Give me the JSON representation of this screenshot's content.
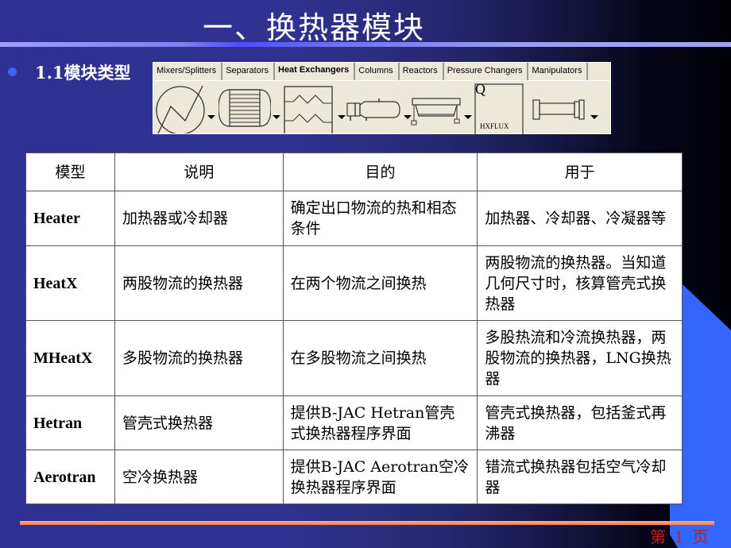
{
  "slide": {
    "title": "一、换热器模块",
    "subtitle": "1.1模块类型",
    "page_label": "第 1 页"
  },
  "palette": {
    "tabs": [
      {
        "label": "Mixers/Splitters",
        "active": false
      },
      {
        "label": "Separators",
        "active": false
      },
      {
        "label": "Heat Exchangers",
        "active": true
      },
      {
        "label": "Columns",
        "active": false
      },
      {
        "label": "Reactors",
        "active": false
      },
      {
        "label": "Pressure Changers",
        "active": false
      },
      {
        "label": "Manipulators",
        "active": false
      }
    ],
    "icons": [
      {
        "name": "heater-icon"
      },
      {
        "name": "heatx-icon"
      },
      {
        "name": "mheatx-icon"
      },
      {
        "name": "hetran-icon"
      },
      {
        "name": "aerotran-icon"
      },
      {
        "name": "hxflux-icon",
        "label": "HXFLUX",
        "glyph": "Q"
      },
      {
        "name": "hetran-manipulator-icon"
      }
    ]
  },
  "table": {
    "headers": [
      "模型",
      "说明",
      "目的",
      "用于"
    ],
    "rows": [
      {
        "model": "Heater",
        "desc": "加热器或冷却器",
        "purpose": "确定出口物流的热和相态条件",
        "use": "加热器、冷却器、冷凝器等"
      },
      {
        "model": "HeatX",
        "desc": "两股物流的换热器",
        "purpose": "在两个物流之间换热",
        "use": "两股物流的换热器。当知道几何尺寸时，核算管壳式换热器"
      },
      {
        "model": "MHeatX",
        "desc": "多股物流的换热器",
        "purpose": "在多股物流之间换热",
        "use": "多股热流和冷流换热器，两股物流的换热器，LNG换热器"
      },
      {
        "model": "Hetran",
        "desc": "管壳式换热器",
        "purpose": "提供B-JAC Hetran管壳式换热器程序界面",
        "use": "管壳式换热器，包括釜式再沸器"
      },
      {
        "model": "Aerotran",
        "desc": "空冷换热器",
        "purpose": "提供B-JAC Aerotran空冷换热器程序界面",
        "use": "错流式换热器包括空气冷却器"
      }
    ]
  }
}
